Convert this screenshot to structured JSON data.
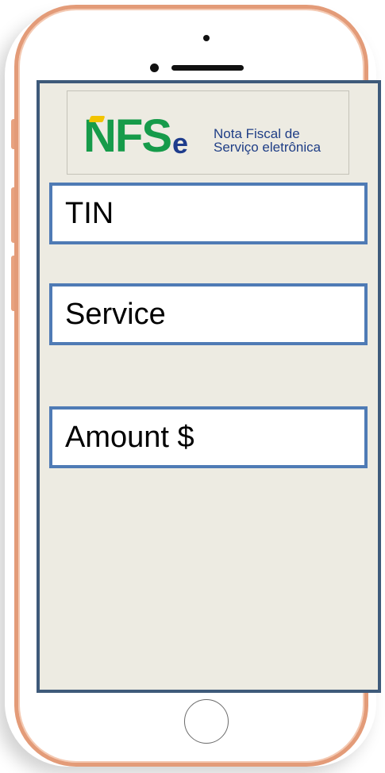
{
  "app": {
    "logo": {
      "letters": "NFS",
      "e_letter": "e",
      "tagline_line1": "Nota Fiscal de",
      "tagline_line2": "Serviço eletrônica"
    },
    "fields": [
      {
        "label": "TIN"
      },
      {
        "label": "Service"
      },
      {
        "label": "Amount $"
      }
    ]
  },
  "colors": {
    "phone_frame": "#e39b78",
    "screen_bg": "#edebe2",
    "screen_border": "#3e5a7a",
    "field_border": "#4f7bb5",
    "logo_green": "#169b4a",
    "logo_blue": "#1e3c8c",
    "logo_yellow": "#f2c400"
  }
}
